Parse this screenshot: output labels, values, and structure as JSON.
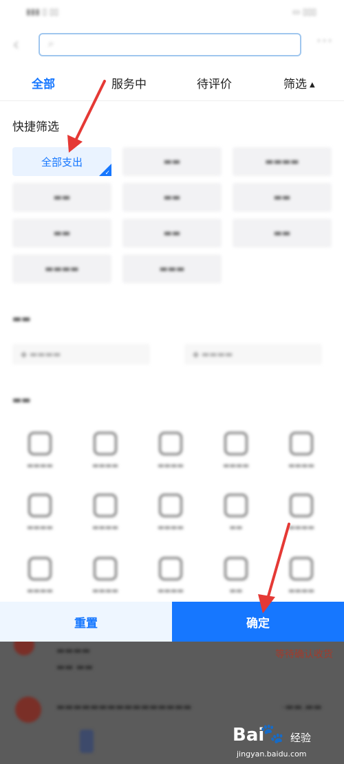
{
  "tabs": [
    {
      "label": "全部",
      "active": true
    },
    {
      "label": "服务中",
      "active": false
    },
    {
      "label": "待评价",
      "active": false
    },
    {
      "label": "筛选",
      "active": false
    }
  ],
  "quick_filter": {
    "title": "快捷筛选",
    "selected_chip": "全部支出"
  },
  "footer": {
    "reset_label": "重置",
    "confirm_label": "确定"
  },
  "background_list": {
    "status_text": "等待确认收货"
  },
  "watermark": {
    "logo": "Bai",
    "brand_text": "经验",
    "url": "jingyan.baidu.com"
  },
  "icons": {
    "back": "chevron-left-icon",
    "search": "search-icon",
    "more": "more-dots-icon",
    "filter_caret": "caret-up-icon",
    "chip_check": "check-icon",
    "watermark_paw": "paw-icon"
  },
  "colors": {
    "accent": "#1677ff",
    "selected_chip_bg": "#eaf3ff",
    "reset_bg": "#eef6ff",
    "annotation_arrow": "#e53935",
    "status_red": "#a23b2c"
  }
}
